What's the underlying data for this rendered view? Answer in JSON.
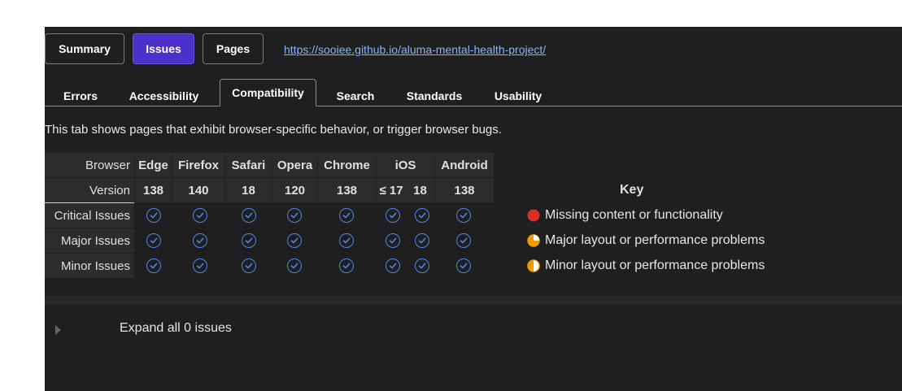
{
  "top_buttons": [
    {
      "label": "Summary",
      "active": false
    },
    {
      "label": "Issues",
      "active": true
    },
    {
      "label": "Pages",
      "active": false
    }
  ],
  "url": "https://sooiee.github.io/aluma-mental-health-project/",
  "tabs": [
    {
      "label": "Errors",
      "active": false
    },
    {
      "label": "Accessibility",
      "active": false
    },
    {
      "label": "Compatibility",
      "active": true
    },
    {
      "label": "Search",
      "active": false
    },
    {
      "label": "Standards",
      "active": false
    },
    {
      "label": "Usability",
      "active": false
    }
  ],
  "intro": "This tab shows pages that exhibit browser-specific behavior, or trigger browser bugs.",
  "table": {
    "browser_label": "Browser",
    "version_label": "Version",
    "browsers": [
      "Edge",
      "Firefox",
      "Safari",
      "Opera",
      "Chrome",
      "iOS",
      "Android"
    ],
    "versions": [
      "138",
      "140",
      "18",
      "120",
      "138",
      "≤ 17",
      "18",
      "138"
    ],
    "rows": [
      "Critical Issues",
      "Major Issues",
      "Minor Issues"
    ],
    "check_icon": "check-circle-icon",
    "check_color": "#4f86e8"
  },
  "key": {
    "title": "Key",
    "items": [
      {
        "label": "Missing content or functionality",
        "icon": "red-circle-icon",
        "color": "#d93025"
      },
      {
        "label": "Major layout or performance problems",
        "icon": "pie-three-quarter-icon",
        "color": "#f29900"
      },
      {
        "label": "Minor layout or performance problems",
        "icon": "pie-half-icon",
        "color": "#f29900"
      }
    ]
  },
  "expand_label": "Expand all 0 issues"
}
